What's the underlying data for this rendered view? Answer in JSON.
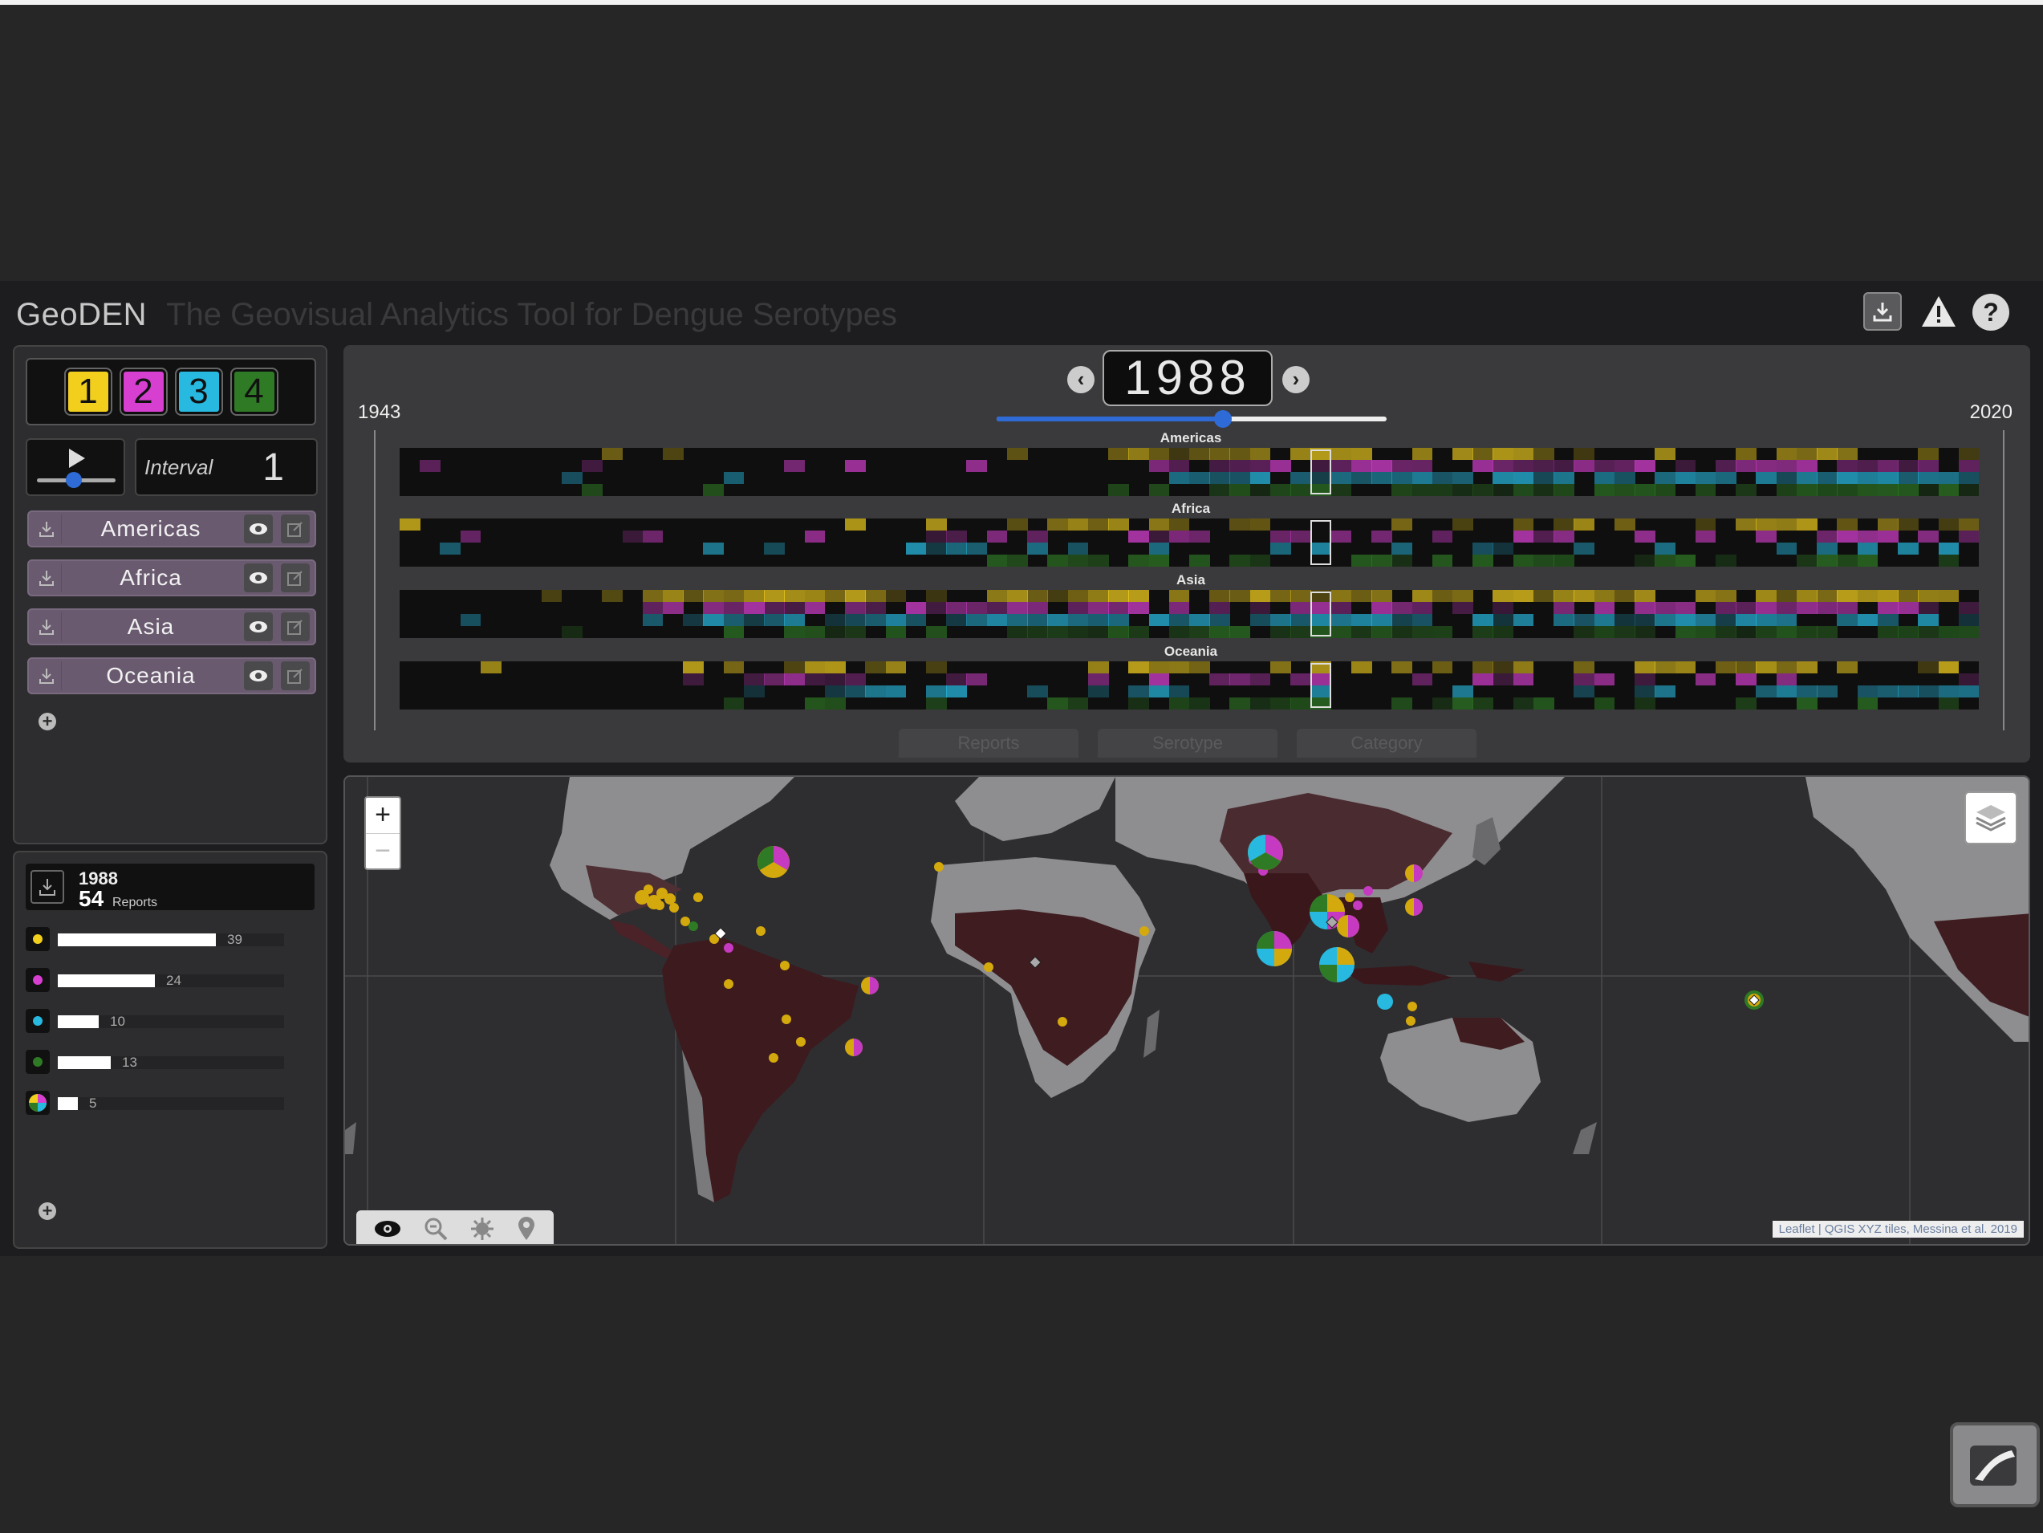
{
  "header": {
    "title": "GeoDEN",
    "subtitle": "The Geovisual Analytics Tool for Dengue Serotypes",
    "icons": [
      "download-icon",
      "warning-icon",
      "help-icon"
    ],
    "help_label": "?"
  },
  "colors": {
    "serotype1": "#f2cf1d",
    "serotype2": "#d63fd0",
    "serotype3": "#27b9e0",
    "serotype4": "#2f7a25",
    "slider": "#2f6bd6"
  },
  "serotypes": [
    {
      "label": "1",
      "color": "#f2cf1d"
    },
    {
      "label": "2",
      "color": "#d63fd0"
    },
    {
      "label": "3",
      "color": "#27b9e0"
    },
    {
      "label": "4",
      "color": "#2f7a25"
    }
  ],
  "playback": {
    "interval_label": "Interval",
    "interval_value": "1"
  },
  "regions": [
    {
      "name": "Americas"
    },
    {
      "name": "Africa"
    },
    {
      "name": "Asia"
    },
    {
      "name": "Oceania"
    }
  ],
  "timeline": {
    "year": "1988",
    "start_year": "1943",
    "end_year": "2020",
    "slider_fraction": 0.58,
    "tabs": [
      "Reports",
      "Serotype",
      "Category"
    ]
  },
  "summary": {
    "year": "1988",
    "count": "54",
    "count_label": "Reports",
    "bars": [
      {
        "icon": "serotype1-dot-icon",
        "value": 39,
        "label": "39"
      },
      {
        "icon": "serotype2-dot-icon",
        "value": 24,
        "label": "24"
      },
      {
        "icon": "serotype3-dot-icon",
        "value": 10,
        "label": "10"
      },
      {
        "icon": "serotype4-dot-icon",
        "value": 13,
        "label": "13"
      },
      {
        "icon": "multi-serotype-pie-icon",
        "value": 5,
        "label": "5"
      }
    ]
  },
  "map": {
    "zoom_in": "+",
    "zoom_out": "−",
    "toolbar_icons": [
      "eye-icon",
      "zoom-out-icon",
      "virus-icon",
      "pin-icon"
    ],
    "attribution": "Leaflet | QGIS XYZ tiles, Messina et al. 2019"
  }
}
